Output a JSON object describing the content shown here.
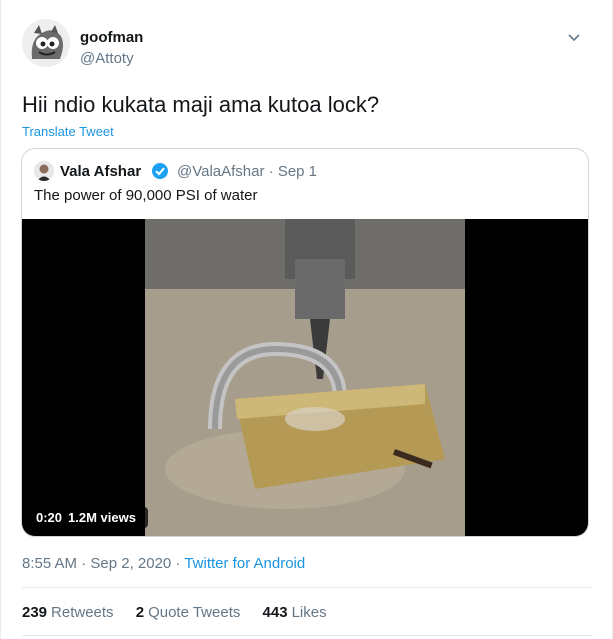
{
  "tweet": {
    "author_name": "goofman",
    "author_handle": "@Attoty",
    "text": "Hii ndio kukata maji ama kutoa lock?",
    "translate_label": "Translate Tweet",
    "timestamp": "8:55 AM · Sep 2, 2020",
    "separator": " · ",
    "source": "Twitter for Android"
  },
  "quoted": {
    "author_name": "Vala Afshar",
    "author_handle_date": "@ValaAfshar · Sep 1",
    "text": "The power of 90,000 PSI of water",
    "video": {
      "duration": "0:20",
      "views": "1.2M views"
    }
  },
  "stats": {
    "retweets_count": "239",
    "retweets_label": "Retweets",
    "quotes_count": "2",
    "quotes_label": "Quote Tweets",
    "likes_count": "443",
    "likes_label": "Likes"
  },
  "colors": {
    "link": "#1b95e0",
    "muted": "#657786",
    "border": "#ccd6dd"
  },
  "icons": [
    "avatar-image",
    "chevron-down-icon",
    "verified-badge-icon",
    "video-thumbnail"
  ]
}
